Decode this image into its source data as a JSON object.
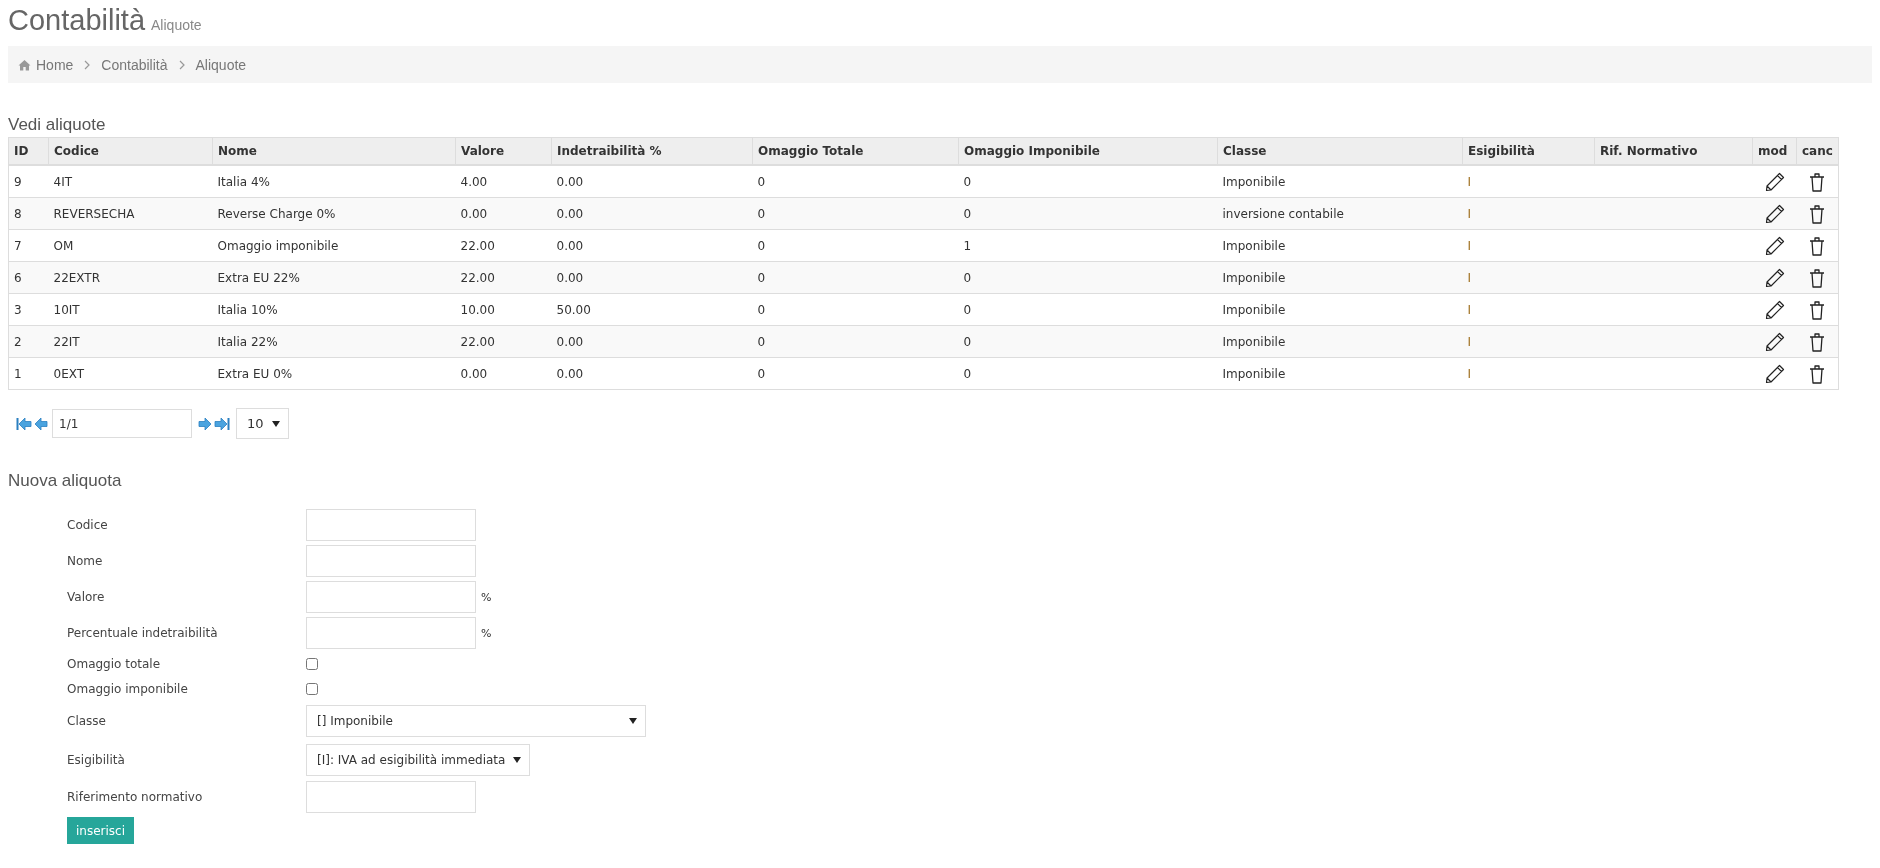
{
  "header": {
    "title": "Contabilità",
    "subtitle": "Aliquote"
  },
  "breadcrumb": [
    {
      "label": "Home",
      "kind": "home"
    },
    {
      "label": "Contabilità",
      "kind": "link"
    },
    {
      "label": "Aliquote",
      "kind": "current"
    }
  ],
  "list_section": {
    "title": "Vedi aliquote"
  },
  "table": {
    "columns": [
      "ID",
      "Codice",
      "Nome",
      "Valore",
      "Indetraibilità %",
      "Omaggio Totale",
      "Omaggio Imponibile",
      "Classe",
      "Esigibilità",
      "Rif. Normativo",
      "mod",
      "canc"
    ],
    "rows": [
      {
        "cells": [
          "9",
          "4IT",
          "Italia 4%",
          "4.00",
          "0.00",
          "0",
          "0",
          "Imponibile",
          "I",
          ""
        ]
      },
      {
        "cells": [
          "8",
          "REVERSECHA",
          "Reverse Charge 0%",
          "0.00",
          "0.00",
          "0",
          "0",
          "inversione contabile",
          "I",
          ""
        ]
      },
      {
        "cells": [
          "7",
          "OM",
          "Omaggio imponibile",
          "22.00",
          "0.00",
          "0",
          "1",
          "Imponibile",
          "I",
          ""
        ]
      },
      {
        "cells": [
          "6",
          "22EXTR",
          "Extra EU 22%",
          "22.00",
          "0.00",
          "0",
          "0",
          "Imponibile",
          "I",
          ""
        ]
      },
      {
        "cells": [
          "3",
          "10IT",
          "Italia 10%",
          "10.00",
          "50.00",
          "0",
          "0",
          "Imponibile",
          "I",
          ""
        ]
      },
      {
        "cells": [
          "2",
          "22IT",
          "Italia 22%",
          "22.00",
          "0.00",
          "0",
          "0",
          "Imponibile",
          "I",
          ""
        ]
      },
      {
        "cells": [
          "1",
          "0EXT",
          "Extra EU 0%",
          "0.00",
          "0.00",
          "0",
          "0",
          "Imponibile",
          "I",
          ""
        ]
      }
    ]
  },
  "pagination": {
    "page": "1/1",
    "page_size": "10"
  },
  "form": {
    "title": "Nuova aliquota",
    "fields": [
      {
        "label": "Codice",
        "kind": "text"
      },
      {
        "label": "Nome",
        "kind": "text"
      },
      {
        "label": "Valore",
        "kind": "text",
        "suffix": "%"
      },
      {
        "label": "Percentuale indetraibilità",
        "kind": "text",
        "suffix": "%"
      },
      {
        "label": "Omaggio totale",
        "kind": "checkbox",
        "checked": false
      },
      {
        "label": "Omaggio imponibile",
        "kind": "checkbox",
        "checked": false
      },
      {
        "label": "Classe",
        "kind": "select",
        "value": "[] Imponibile",
        "wide": true
      },
      {
        "label": "Esigibilità",
        "kind": "select",
        "value": "[I]: IVA ad esigibilità immediata",
        "wide": false
      },
      {
        "label": "Riferimento normativo",
        "kind": "text"
      }
    ],
    "submit": "inserisci"
  }
}
